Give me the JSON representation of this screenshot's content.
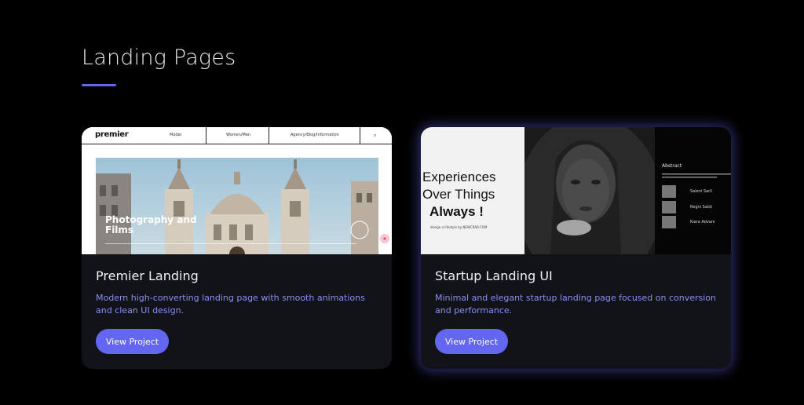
{
  "section": {
    "title": "Landing Pages"
  },
  "projects": [
    {
      "title": "Premier Landing",
      "description": "Modern high-converting landing page with smooth animations and clean UI design.",
      "button": "View Project",
      "thumbnail": {
        "logo": "premier",
        "nav_links": [
          "Model",
          "Women/Men",
          "Agency/Blog/Information"
        ],
        "hero_text": "Photography and Films"
      }
    },
    {
      "title": "Startup Landing UI",
      "description": "Minimal and elegant startup landing page focused on conversion and performance.",
      "button": "View Project",
      "thumbnail": {
        "line1": "Experiences",
        "line2": "Over Things",
        "line3": "Always !",
        "small_text": "design a lifestyle by NEWCRAB.COM",
        "sidebar_title": "Abstract",
        "people": [
          "Saleni Sarli",
          "Regni Saidi",
          "Kiara Advani"
        ]
      }
    }
  ],
  "colors": {
    "accent": "#6366f1",
    "card": "#121219",
    "page": "#000000",
    "desc": "#8b8ff0"
  }
}
